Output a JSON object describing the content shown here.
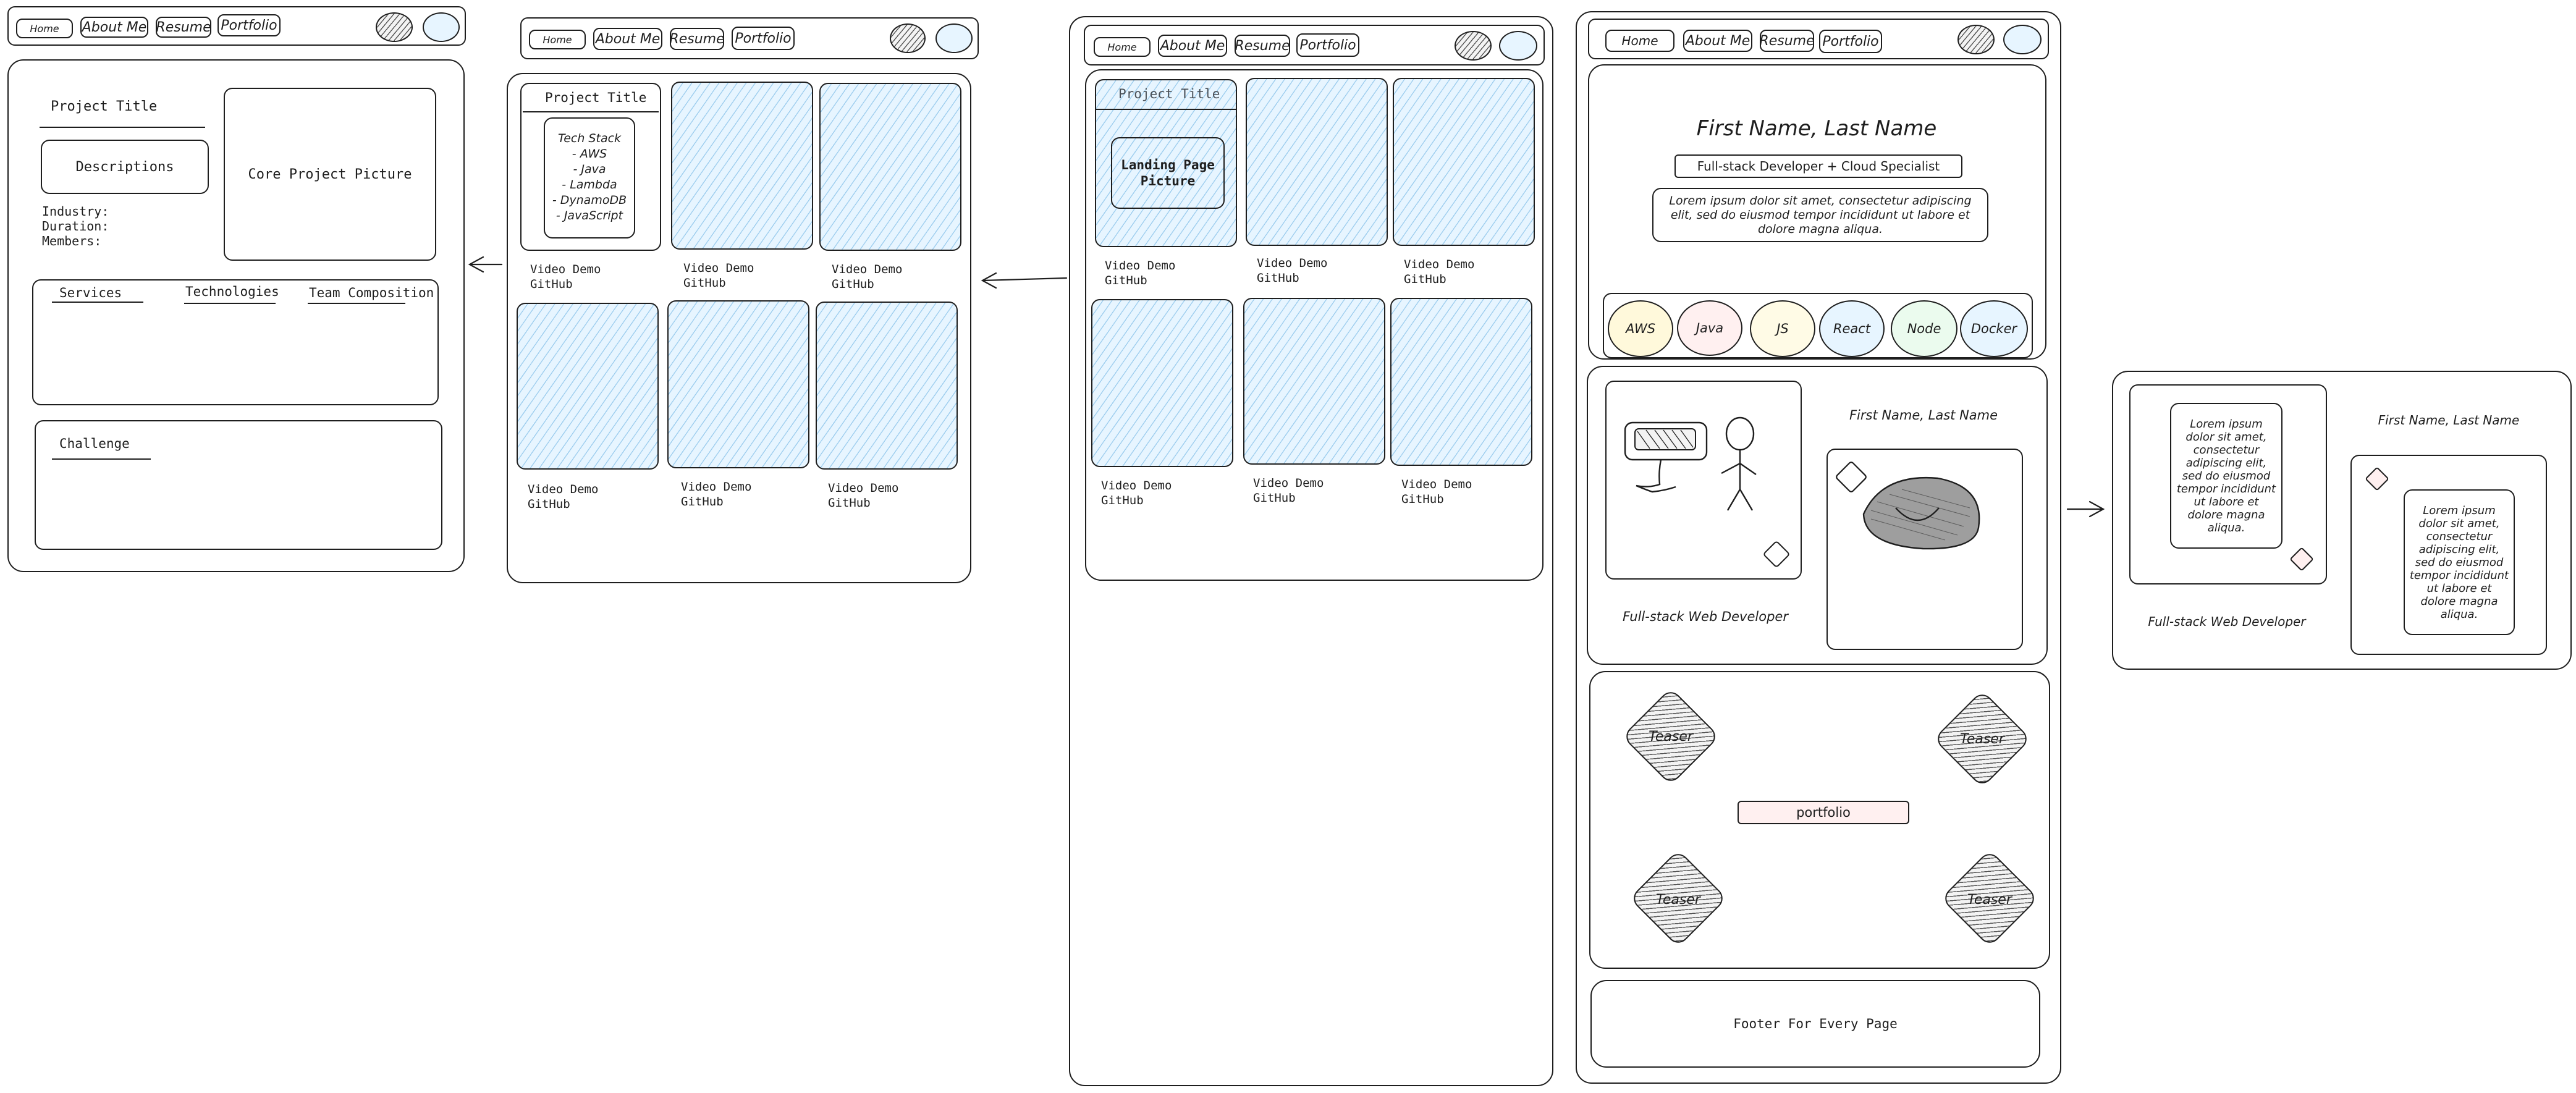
{
  "nav": {
    "home": "Home",
    "about": "About Me",
    "resume": "Resume",
    "portfolio": "Portfolio"
  },
  "project_detail": {
    "project_title": "Project Title",
    "descriptions": "Descriptions",
    "core_picture": "Core Project Picture",
    "industry": "Industry:",
    "duration": "Duration:",
    "members": "Members:",
    "tabs": [
      "Services",
      "Technologies",
      "Team Composition"
    ],
    "challenge": "Challenge"
  },
  "portfolio_grid": {
    "project_title": "Project Title",
    "tech_stack": [
      "Tech Stack",
      "- AWS",
      "- Java",
      "- Lambda",
      "- DynamoDB",
      "- JavaScript"
    ],
    "video_demo": "Video Demo",
    "github": "GitHub"
  },
  "portfolio_landing": {
    "project_title": "Project Title",
    "landing_picture": "Landing Page Picture",
    "video_demo": "Video Demo",
    "github": "GitHub"
  },
  "home": {
    "name": "First Name, Last Name",
    "tagline": "Full-stack Developer + Cloud Specialist",
    "intro": "Lorem ipsum dolor sit amet, consectetur adipiscing elit, sed do eiusmod tempor incididunt ut labore et dolore magna aliqua.",
    "skills": [
      {
        "label": "AWS",
        "color": "#fff9db"
      },
      {
        "label": "Java",
        "color": "#fff0f0"
      },
      {
        "label": "JS",
        "color": "#fffbe6"
      },
      {
        "label": "React",
        "color": "#e7f5ff"
      },
      {
        "label": "Node",
        "color": "#ebfbee"
      },
      {
        "label": "Docker",
        "color": "#e7f5ff"
      }
    ],
    "about_name": "First Name, Last Name",
    "about_role": "Full-stack Web Developer",
    "teaser": "Teaser",
    "portfolio_button": "portfolio",
    "footer": "Footer For Every Page"
  },
  "about_detail": {
    "name": "First Name, Last Name",
    "role": "Full-stack Web Developer",
    "lorem": "Lorem ipsum dolor sit amet, consectetur adipiscing elit, sed do eiusmod tempor incididunt ut labore et dolore magna aliqua."
  },
  "colors": {
    "stroke": "#1e1e1e",
    "light_blue": "#e7f5ff",
    "hatch_blue": "#64afe1",
    "pink": "#fff0f0"
  }
}
